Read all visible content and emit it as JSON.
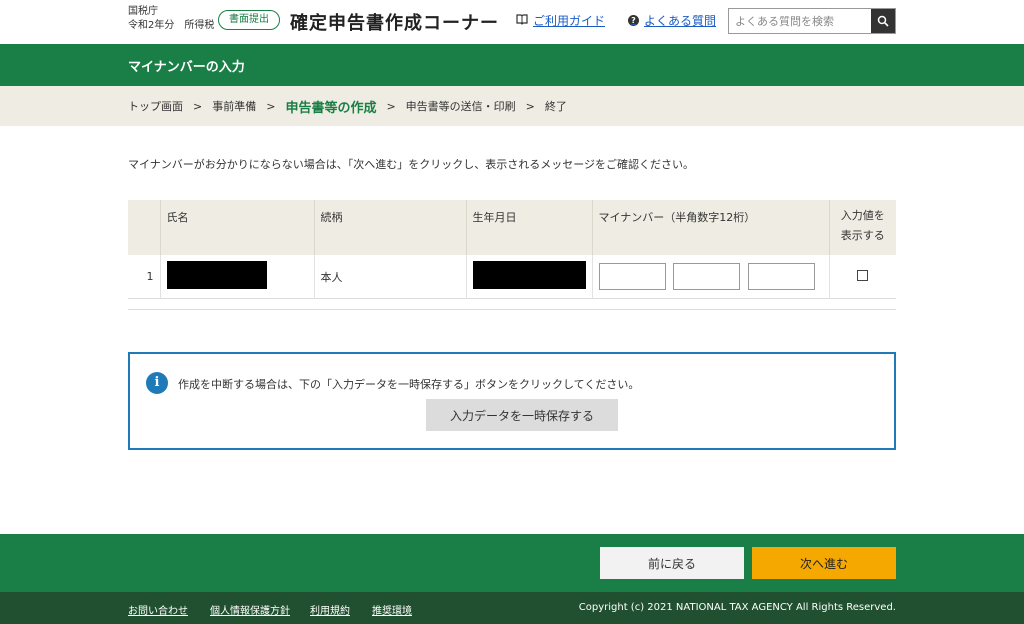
{
  "header": {
    "agency": "国税庁",
    "year_tax": "令和2年分　所得税",
    "badge": "書面提出",
    "title": "確定申告書作成コーナー",
    "guide_link": "ご利用ガイド",
    "faq_link": "よくある質問",
    "search_placeholder": "よくある質問を検索"
  },
  "page_title": "マイナンバーの入力",
  "breadcrumb": [
    "トップ画面",
    "事前準備",
    "申告書等の作成",
    "申告書等の送信・印刷",
    "終了"
  ],
  "instruction": "マイナンバーがお分かりにならない場合は、「次へ進む」をクリックし、表示されるメッセージをご確認ください。",
  "table": {
    "headers": [
      "",
      "氏名",
      "続柄",
      "生年月日",
      "マイナンバー（半角数字12桁）",
      "入力値を",
      "表示する"
    ],
    "rows": [
      {
        "num": "1",
        "relation": "本人"
      }
    ]
  },
  "info": {
    "text": "作成を中断する場合は、下の「入力データを一時保存する」ボタンをクリックしてください。",
    "save_button": "入力データを一時保存する"
  },
  "nav": {
    "back": "前に戻る",
    "next": "次へ進む"
  },
  "footer": {
    "links": [
      "お問い合わせ",
      "個人情報保護方針",
      "利用規約",
      "推奨環境"
    ],
    "copyright": "Copyright (c) 2021 NATIONAL TAX AGENCY All Rights Reserved."
  },
  "colors": {
    "brand_green": "#1a7f46",
    "accent_orange": "#f5a800",
    "info_blue": "#1f7ab8"
  }
}
